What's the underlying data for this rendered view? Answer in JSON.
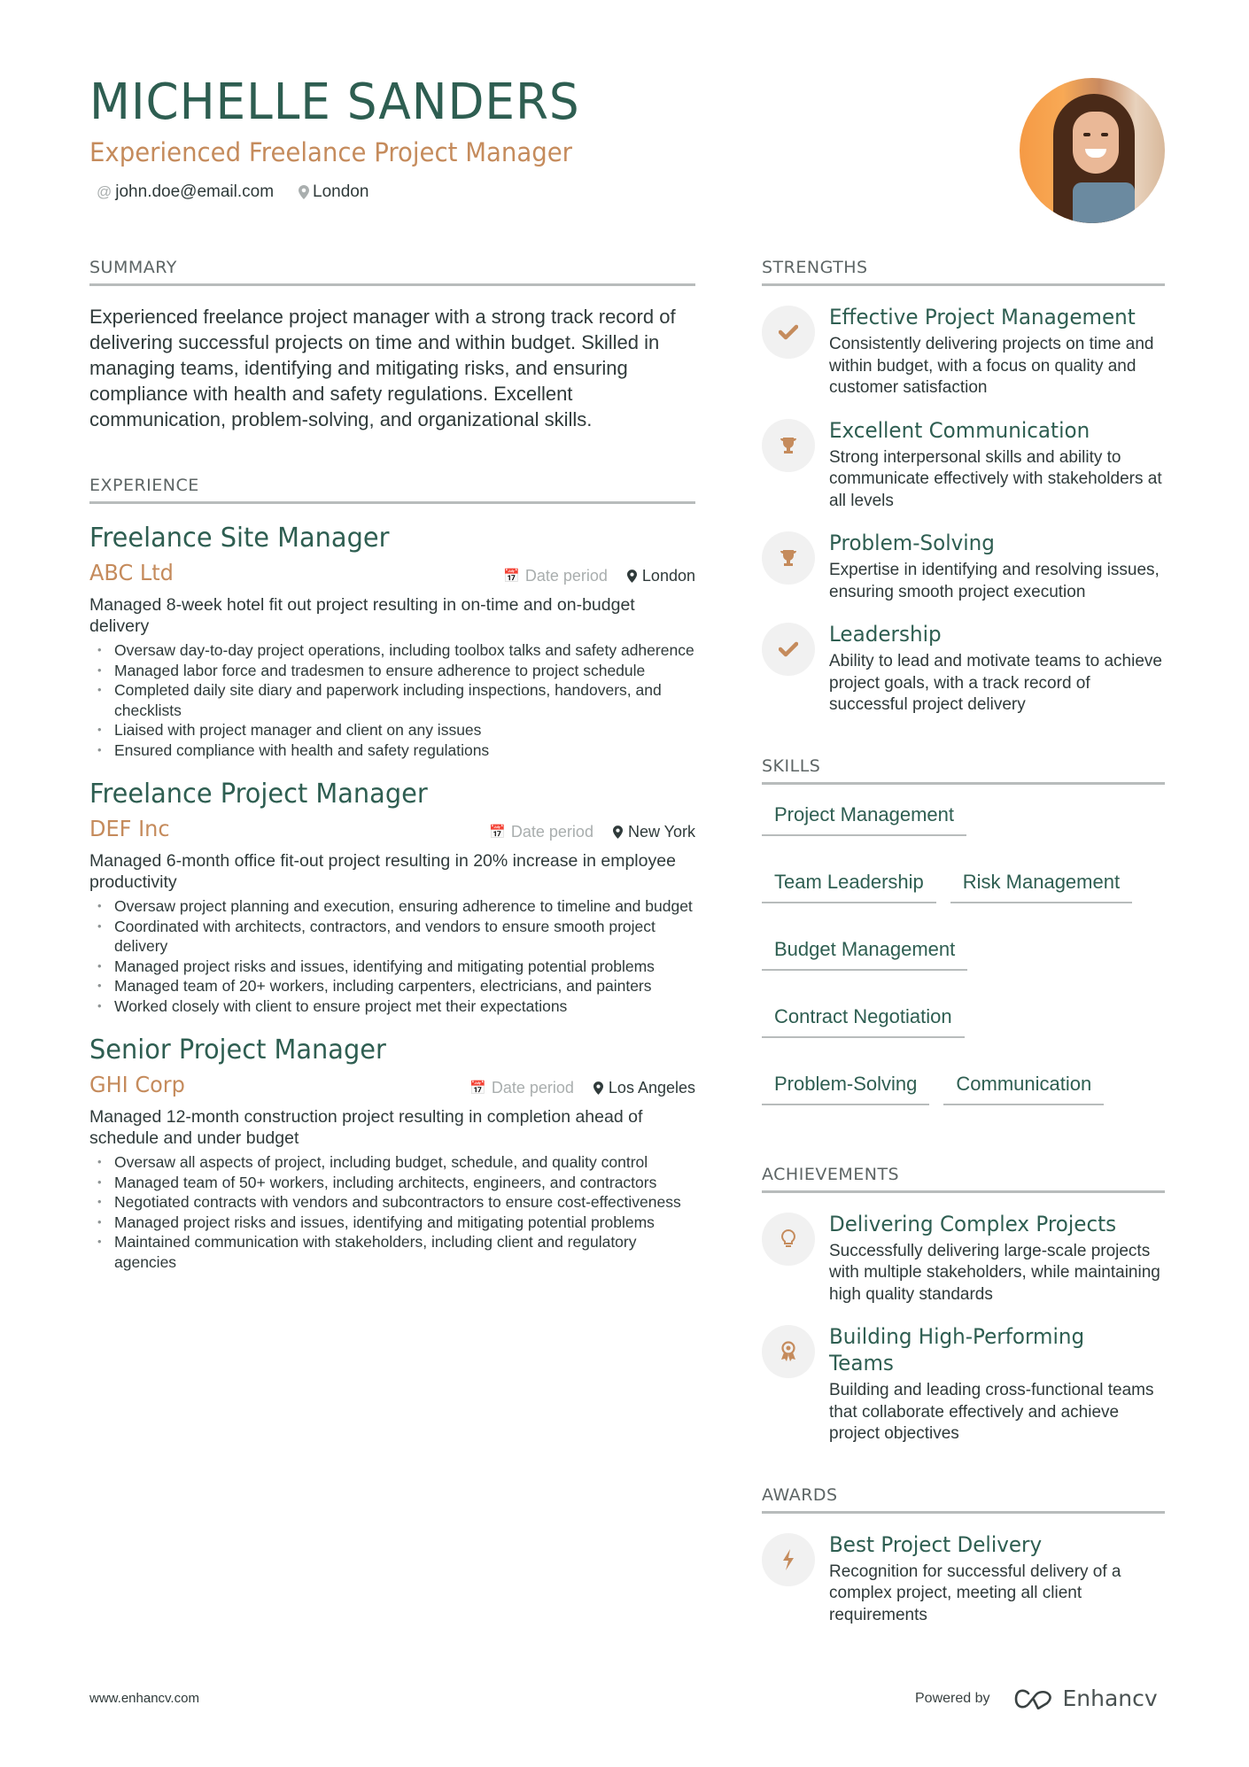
{
  "header": {
    "name": "MICHELLE SANDERS",
    "title": "Experienced Freelance Project Manager",
    "email": "john.doe@email.com",
    "location": "London"
  },
  "summary": {
    "heading": "SUMMARY",
    "text": "Experienced freelance project manager with a strong track record of delivering successful projects on time and within budget. Skilled in managing teams, identifying and mitigating risks, and ensuring compliance with health and safety regulations. Excellent communication, problem-solving, and organizational skills."
  },
  "experience": {
    "heading": "EXPERIENCE",
    "jobs": [
      {
        "title": "Freelance Site Manager",
        "company": "ABC Ltd",
        "date": "Date period",
        "location": "London",
        "description": "Managed 8-week hotel fit out project resulting in on-time and on-budget delivery",
        "bullets": [
          "Oversaw day-to-day project operations, including toolbox talks and safety adherence",
          "Managed labor force and tradesmen to ensure adherence to project schedule",
          "Completed daily site diary and paperwork including inspections, handovers, and checklists",
          "Liaised with project manager and client on any issues",
          "Ensured compliance with health and safety regulations"
        ]
      },
      {
        "title": "Freelance Project Manager",
        "company": "DEF Inc",
        "date": "Date period",
        "location": "New York",
        "description": "Managed 6-month office fit-out project resulting in 20% increase in employee productivity",
        "bullets": [
          "Oversaw project planning and execution, ensuring adherence to timeline and budget",
          "Coordinated with architects, contractors, and vendors to ensure smooth project delivery",
          "Managed project risks and issues, identifying and mitigating potential problems",
          "Managed team of 20+ workers, including carpenters, electricians, and painters",
          "Worked closely with client to ensure project met their expectations"
        ]
      },
      {
        "title": "Senior Project Manager",
        "company": "GHI Corp",
        "date": "Date period",
        "location": "Los Angeles",
        "description": "Managed 12-month construction project resulting in completion ahead of schedule and under budget",
        "bullets": [
          "Oversaw all aspects of project, including budget, schedule, and quality control",
          "Managed team of 50+ workers, including architects, engineers, and contractors",
          "Negotiated contracts with vendors and subcontractors to ensure cost-effectiveness",
          "Managed project risks and issues, identifying and mitigating potential problems",
          "Maintained communication with stakeholders, including client and regulatory agencies"
        ]
      }
    ]
  },
  "strengths": {
    "heading": "STRENGTHS",
    "items": [
      {
        "icon": "check-icon",
        "title": "Effective Project Management",
        "description": "Consistently delivering projects on time and within budget, with a focus on quality and customer satisfaction"
      },
      {
        "icon": "trophy-icon",
        "title": "Excellent Communication",
        "description": "Strong interpersonal skills and ability to communicate effectively with stakeholders at all levels"
      },
      {
        "icon": "trophy-icon",
        "title": "Problem-Solving",
        "description": "Expertise in identifying and resolving issues, ensuring smooth project execution"
      },
      {
        "icon": "check-icon",
        "title": "Leadership",
        "description": "Ability to lead and motivate teams to achieve project goals, with a track record of successful project delivery"
      }
    ]
  },
  "skills": {
    "heading": "SKILLS",
    "items": [
      "Project Management",
      "Team Leadership",
      "Risk Management",
      "Budget Management",
      "Contract Negotiation",
      "Problem-Solving",
      "Communication"
    ]
  },
  "achievements": {
    "heading": "ACHIEVEMENTS",
    "items": [
      {
        "icon": "lightbulb-icon",
        "title": "Delivering Complex Projects",
        "description": "Successfully delivering large-scale projects with multiple stakeholders, while maintaining high quality standards"
      },
      {
        "icon": "medal-icon",
        "title": "Building High-Performing Teams",
        "description": "Building and leading cross-functional teams that collaborate effectively and achieve project objectives"
      }
    ]
  },
  "awards": {
    "heading": "AWARDS",
    "items": [
      {
        "icon": "lightning-icon",
        "title": "Best Project Delivery",
        "description": "Recognition for successful delivery of a complex project, meeting all client requirements"
      }
    ]
  },
  "footer": {
    "website": "www.enhancv.com",
    "powered_by": "Powered by",
    "brand": "Enhancv"
  },
  "colors": {
    "accent_green": "#2e5e51",
    "accent_orange": "#c58b5c",
    "text": "#2f3a3a",
    "rule": "#b8bcbc"
  }
}
